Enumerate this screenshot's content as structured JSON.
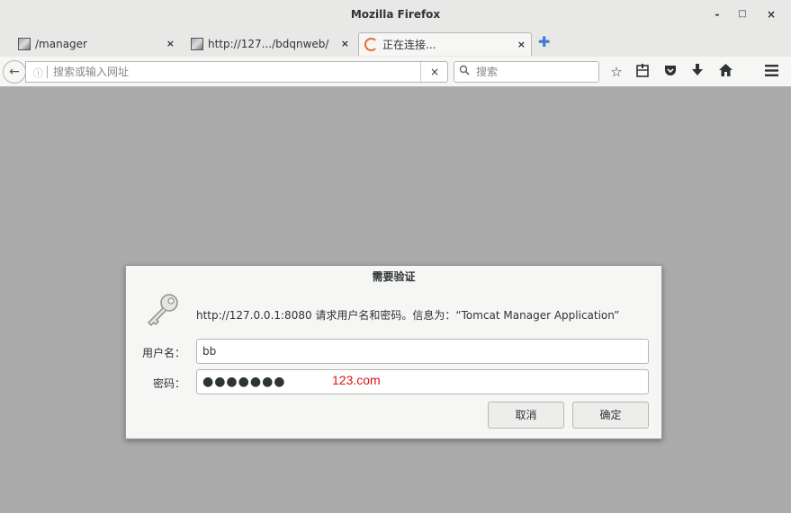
{
  "window": {
    "title": "Mozilla Firefox",
    "minimize": "-",
    "maximize": "□",
    "close": "×"
  },
  "tabs": [
    {
      "label": "/manager",
      "close": "×"
    },
    {
      "label": "http://127.../bdqnweb/",
      "close": "×"
    },
    {
      "label": "正在连接...",
      "close": "×"
    }
  ],
  "new_tab": "✚",
  "navbar": {
    "back": "←",
    "info": "ⓘ",
    "url_placeholder": "搜索或输入网址",
    "url_value": "",
    "clear": "×",
    "search_icon": "🔍",
    "search_placeholder": "搜索",
    "tools": [
      "☆",
      "⊟",
      "⛉",
      "⬇",
      "⌂",
      "☰"
    ]
  },
  "dialog": {
    "title": "需要验证",
    "message": "http://127.0.0.1:8080 请求用户名和密码。信息为：“Tomcat Manager Application”",
    "username_label": "用户名：",
    "username_value": "bb",
    "password_label": "密码：",
    "password_mask": "●●●●●●●",
    "annotation": "123.com",
    "cancel": "取消",
    "ok": "确定"
  },
  "colors": {
    "page_bg": "#ababab",
    "accent": "#3b7bd4",
    "loading": "#e66a2c",
    "annotation": "#e01010"
  }
}
